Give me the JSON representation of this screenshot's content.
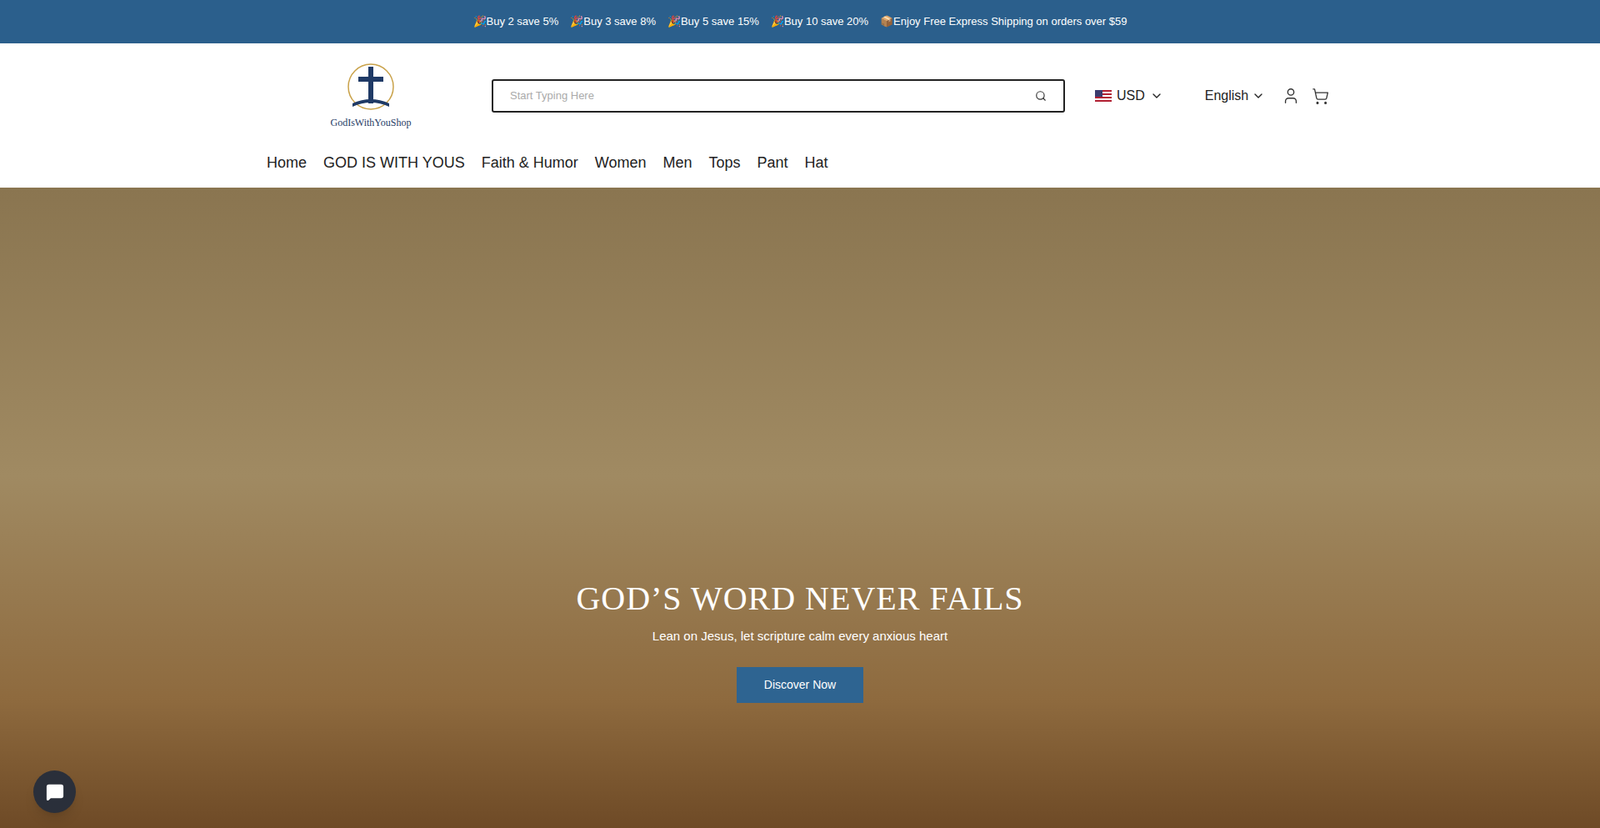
{
  "announcement": {
    "items": [
      "🎉Buy 2 save 5%",
      "🎉Buy 3 save 8%",
      "🎉Buy 5 save 15%",
      "🎉Buy 10 save 20%",
      "📦Enjoy Free Express Shipping on orders over $59"
    ]
  },
  "logo": {
    "text": "GodIsWithYouShop"
  },
  "search": {
    "placeholder": "Start Typing Here"
  },
  "currency": {
    "label": "USD"
  },
  "language": {
    "label": "English"
  },
  "nav": [
    {
      "label": "Home"
    },
    {
      "label": "GOD IS WITH YOUS"
    },
    {
      "label": "Faith & Humor"
    },
    {
      "label": "Women"
    },
    {
      "label": "Men"
    },
    {
      "label": "Tops"
    },
    {
      "label": "Pant"
    },
    {
      "label": "Hat"
    }
  ],
  "hero": {
    "title": "GOD’S WORD NEVER FAILS",
    "subtitle": "Lean on Jesus, let scripture calm every anxious heart",
    "button": "Discover Now"
  }
}
